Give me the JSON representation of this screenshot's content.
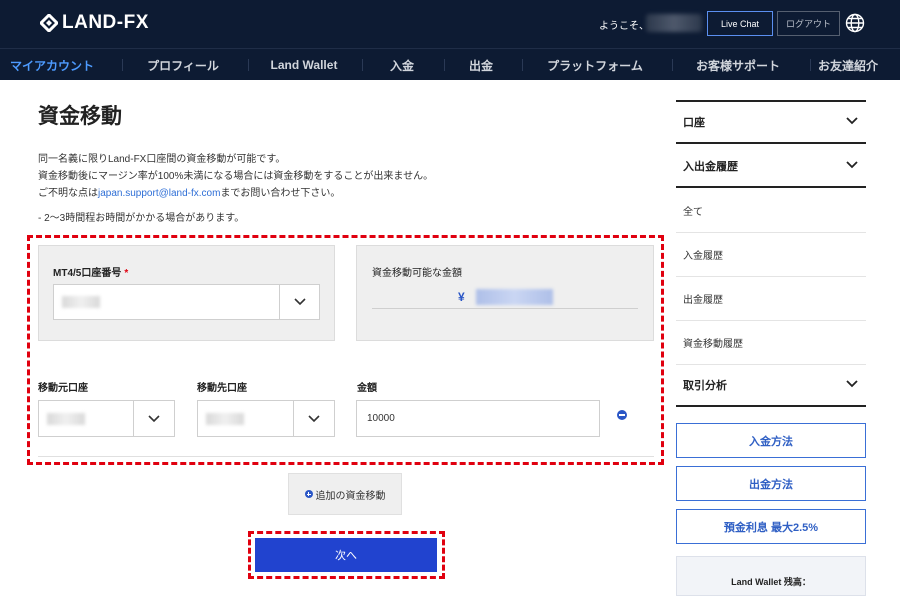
{
  "header": {
    "brand": "LAND-FX",
    "welcome": "ようこそ、",
    "live_chat": "Live Chat",
    "logout": "ログアウト"
  },
  "nav": {
    "items": [
      {
        "label": "マイアカウント",
        "active": true
      },
      {
        "label": "プロフィール"
      },
      {
        "label": "Land Wallet"
      },
      {
        "label": "入金"
      },
      {
        "label": "出金"
      },
      {
        "label": "プラットフォーム"
      },
      {
        "label": "お客様サポート"
      },
      {
        "label": "お友達紹介"
      }
    ]
  },
  "main": {
    "title": "資金移動",
    "desc_1": "同一名義に限りLand-FX口座間の資金移動が可能です。",
    "desc_2": "資金移動後にマージン率が100%未満になる場合には資金移動をすることが出来ません。",
    "desc_3_prefix": "ご不明な点は",
    "desc_3_email": "japan.support@land-fx.com",
    "desc_3_suffix": "までお問い合わせ下さい。",
    "note": "- 2〜3時間程お時間がかかる場合があります。",
    "account_label": "MT4/5口座番号",
    "required_mark": "*",
    "available_label": "資金移動可能な金額",
    "currency_symbol": "¥",
    "from_label": "移動元口座",
    "to_label": "移動先口座",
    "amount_label": "金額",
    "amount_value": "10000",
    "add_transfer": "追加の資金移動",
    "next": "次へ"
  },
  "sidebar": {
    "account": "口座",
    "history": "入出金履歴",
    "history_items": [
      "全て",
      "入金履歴",
      "出金履歴",
      "資金移動履歴"
    ],
    "analysis": "取引分析",
    "deposit_methods": "入金方法",
    "withdraw_methods": "出金方法",
    "interest": "預金利息 最大2.5%",
    "wallet_balance": "Land Wallet 残高："
  },
  "colors": {
    "header_bg": "#0d1b33",
    "nav_active": "#4d9bff",
    "primary_button": "#2143cf",
    "highlight_dash": "#e0000f",
    "link": "#2f6fd6"
  }
}
